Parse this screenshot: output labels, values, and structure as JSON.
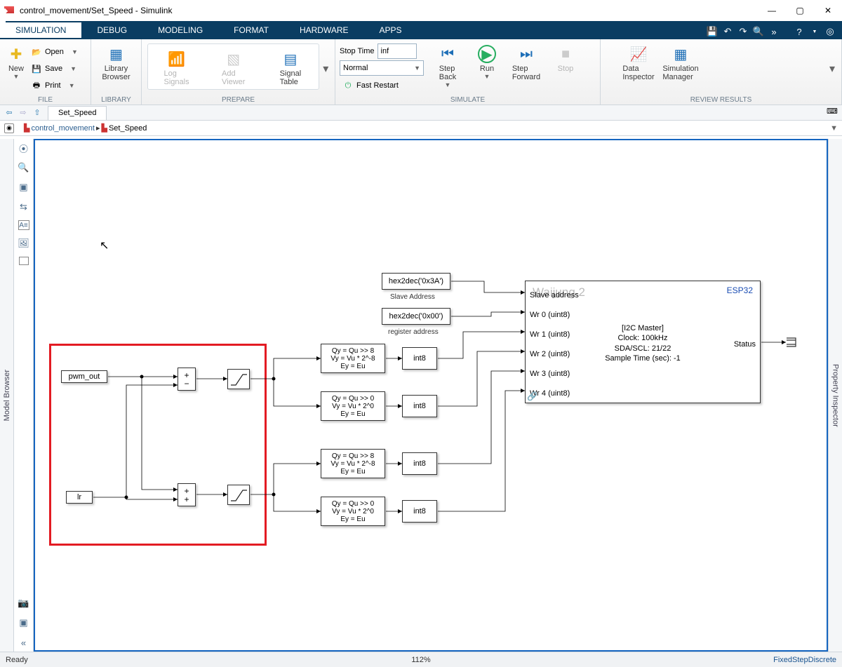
{
  "window": {
    "title": "control_movement/Set_Speed - Simulink"
  },
  "tabs": {
    "sim": "SIMULATION",
    "debug": "DEBUG",
    "model": "MODELING",
    "format": "FORMAT",
    "hw": "HARDWARE",
    "apps": "APPS"
  },
  "file": {
    "new": "New",
    "open": "Open",
    "save": "Save",
    "print": "Print",
    "label": "FILE"
  },
  "library": {
    "btn": "Library\nBrowser",
    "label": "LIBRARY"
  },
  "prepare": {
    "log": "Log\nSignals",
    "add": "Add\nViewer",
    "sig": "Signal\nTable",
    "label": "PREPARE"
  },
  "simgrp": {
    "stoptime": "Stop Time",
    "stopval": "inf",
    "mode": "Normal",
    "fast": "Fast Restart",
    "back": "Step\nBack",
    "run": "Run",
    "fwd": "Step\nForward",
    "stop": "Stop",
    "label": "SIMULATE"
  },
  "review": {
    "di": "Data\nInspector",
    "sm": "Simulation\nManager",
    "label": "REVIEW RESULTS"
  },
  "nav": {
    "tab": "Set_Speed",
    "crumb1": "control_movement",
    "crumb2": "Set_Speed"
  },
  "side": {
    "left": "Model Browser",
    "right": "Property Inspector"
  },
  "canvas": {
    "pwm": "pwm_out",
    "lr": "lr",
    "hex3a": "hex2dec('0x3A')",
    "hex00": "hex2dec('0x00')",
    "slaveaddr": "Slave Address",
    "regaddr": "register address",
    "shift8": "Qy = Qu >> 8\nVy = Vu * 2^-8\nEy = Eu",
    "shift0": "Qy = Qu >> 0\nVy = Vu * 2^0\nEy = Eu",
    "int8": "int8",
    "brand": "Waijung 2",
    "chip": "ESP32",
    "i2c": "[I2C Master]\nClock: 100kHz\nSDA/SCL: 21/22\nSample Time (sec): -1",
    "p0": "Slave address",
    "p1": "Wr 0 (uint8)",
    "p2": "Wr 1 (uint8)",
    "p3": "Wr 2 (uint8)",
    "p4": "Wr 3 (uint8)",
    "p5": "Wr 4 (uint8)",
    "status": "Status"
  },
  "status": {
    "ready": "Ready",
    "zoom": "112%",
    "solver": "FixedStepDiscrete"
  }
}
